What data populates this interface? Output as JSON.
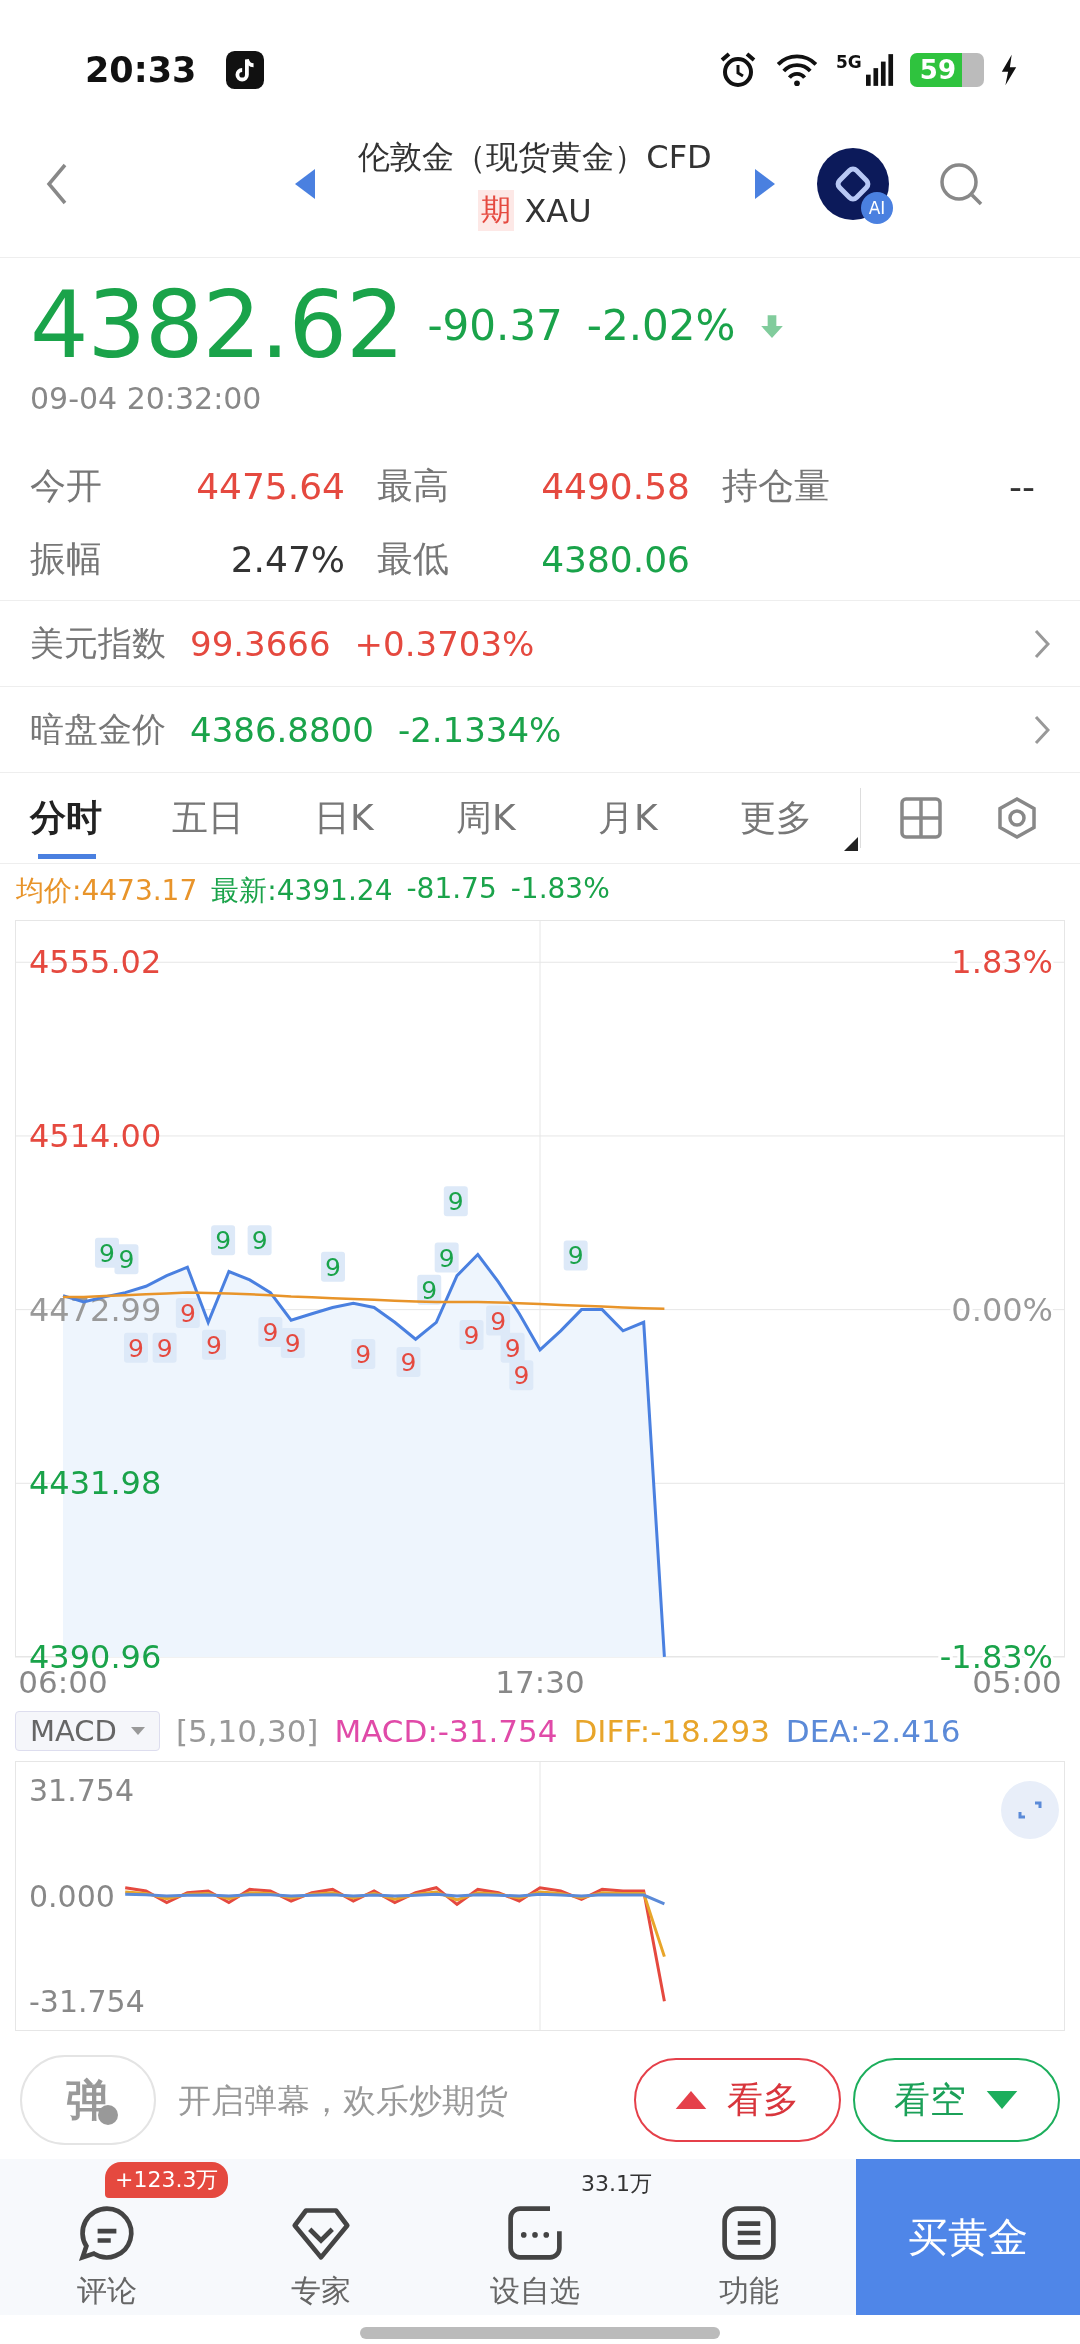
{
  "status_bar": {
    "time": "20:33",
    "network": "5G",
    "battery": "59"
  },
  "header": {
    "title": "伦敦金（现货黄金）CFD",
    "tag": "期",
    "symbol": "XAU",
    "ai_badge": "AI"
  },
  "quote": {
    "price": "4382.62",
    "change": "-90.37",
    "change_pct": "-2.02%",
    "color": "#1aa34a",
    "timestamp": "09-04 20:32:00"
  },
  "stats": [
    {
      "label": "今开",
      "value": "4475.64",
      "color": "#e5493f"
    },
    {
      "label": "最高",
      "value": "4490.58",
      "color": "#e5493f"
    },
    {
      "label": "持仓量",
      "value": "--",
      "color": "#333333"
    },
    {
      "label": "振幅",
      "value": "2.47%",
      "color": "#333333"
    },
    {
      "label": "最低",
      "value": "4380.06",
      "color": "#1aa34a"
    }
  ],
  "related": [
    {
      "label": "美元指数",
      "value": "99.3666",
      "change": "+0.3703%",
      "color": "#e5493f"
    },
    {
      "label": "暗盘金价",
      "value": "4386.8800",
      "change": "-2.1334%",
      "color": "#1aa34a"
    }
  ],
  "tabs": [
    {
      "label": "分时",
      "selected": true
    },
    {
      "label": "五日",
      "selected": false
    },
    {
      "label": "日K",
      "selected": false
    },
    {
      "label": "周K",
      "selected": false
    },
    {
      "label": "月K",
      "selected": false
    },
    {
      "label": "更多",
      "selected": false
    }
  ],
  "legend": {
    "avg": "均价:4473.17",
    "latest": "最新:4391.24",
    "change": "-81.75",
    "change_pct": "-1.83%"
  },
  "price_chart": {
    "right_labels": [
      {
        "label": "1.83%",
        "color": "#e5493f"
      },
      {
        "label": "0.00%",
        "color": "#999999"
      },
      {
        "label": "-1.83%",
        "color": "#1aa34a"
      }
    ],
    "signal_markers": [
      {
        "text": "9",
        "color": "#1aa34a"
      },
      {
        "text": "9",
        "color": "#1aa34a"
      },
      {
        "text": "9",
        "color": "#1aa34a"
      },
      {
        "text": "9",
        "color": "#1aa34a"
      },
      {
        "text": "9",
        "color": "#1aa34a"
      },
      {
        "text": "9",
        "color": "#1aa34a"
      },
      {
        "text": "9",
        "color": "#1aa34a"
      },
      {
        "text": "9",
        "color": "#1aa34a"
      },
      {
        "text": "9",
        "color": "#1aa34a"
      },
      {
        "text": "9",
        "color": "#e5493f"
      },
      {
        "text": "9",
        "color": "#e5493f"
      },
      {
        "text": "9",
        "color": "#e5493f"
      },
      {
        "text": "9",
        "color": "#e5493f"
      },
      {
        "text": "9",
        "color": "#e5493f"
      },
      {
        "text": "9",
        "color": "#e5493f"
      },
      {
        "text": "9",
        "color": "#e5493f"
      },
      {
        "text": "9",
        "color": "#e5493f"
      },
      {
        "text": "9",
        "color": "#e5493f"
      },
      {
        "text": "9",
        "color": "#e5493f"
      },
      {
        "text": "9",
        "color": "#e5493f"
      },
      {
        "text": "9",
        "color": "#e5493f"
      }
    ],
    "chart_data": {
      "type": "line",
      "categories": [
        "06:00",
        null,
        null,
        null,
        null,
        null,
        null,
        null,
        null,
        null,
        null,
        null,
        null,
        null,
        null,
        null,
        null,
        null,
        null,
        null,
        null,
        null,
        null,
        "17:30",
        null,
        null,
        null,
        null,
        null,
        null,
        null,
        null,
        null,
        null,
        null,
        null,
        null,
        null,
        null,
        null,
        null,
        null,
        null,
        null,
        null,
        null,
        "05:00"
      ],
      "series": [
        {
          "color": "#4a80e0",
          "values": [
            4476.3,
            4474.8,
            4476,
            4477,
            4478.5,
            4481,
            4483,
            4470,
            4482,
            4480,
            4477,
            4470.5,
            4472,
            4473.5,
            4474.5,
            4473.5,
            4470,
            4466,
            4470,
            4481,
            4486,
            4479.5,
            4472,
            4463.5,
            4468,
            4473,
            4473,
            4468,
            4470,
            4391,
            null,
            null,
            null,
            null,
            null,
            null,
            null,
            null,
            null,
            null,
            null,
            null,
            null,
            null,
            null,
            null,
            null
          ]
        },
        {
          "color": "#e8942a",
          "values": [
            4476,
            4476,
            4476.2,
            4476.4,
            4476.6,
            4476.8,
            4477,
            4476.9,
            4476.8,
            4476.6,
            4476.4,
            4476.1,
            4475.9,
            4475.7,
            4475.5,
            4475.3,
            4475.1,
            4474.9,
            4474.8,
            4474.8,
            4474.8,
            4474.7,
            4474.5,
            4474.3,
            4474.1,
            4473.9,
            4473.7,
            4473.5,
            4473.3,
            4473.2,
            null,
            null,
            null,
            null,
            null,
            null,
            null,
            null,
            null,
            null,
            null,
            null,
            null,
            null,
            null,
            null,
            null
          ]
        }
      ],
      "ylim": [
        4390.96,
        4565
      ],
      "grid": true,
      "yticks": [
        {
          "value": 4555.02,
          "label": "4555.02"
        },
        {
          "value": 4514.0,
          "label": "4514.00"
        },
        {
          "value": 4472.99,
          "label": "4472.99"
        },
        {
          "value": 4431.98,
          "label": "4431.98"
        },
        {
          "value": 4390.96,
          "label": "4390.96"
        }
      ]
    }
  },
  "indicator": {
    "selector": "MACD",
    "params": "[5,10,30]",
    "macd": "MACD:-31.754",
    "diff": "DIFF:-18.293",
    "dea": "DEA:-2.416"
  },
  "macd_chart": {
    "chart_data": {
      "type": "line",
      "categories": [
        null,
        null,
        null,
        null,
        null,
        null,
        null,
        null,
        null,
        null,
        null,
        null,
        null,
        null,
        null,
        null,
        null,
        null,
        null,
        null,
        null,
        null,
        null,
        null,
        null,
        null,
        null,
        null,
        null,
        null,
        null,
        null,
        null,
        null,
        null,
        null,
        null,
        null,
        null,
        null,
        null,
        null,
        null,
        null,
        null,
        null,
        null
      ],
      "series": [
        {
          "color": "#e5493f",
          "values": [
            null,
            null,
            null,
            2.5,
            1.5,
            -2,
            1,
            1.5,
            -2,
            2,
            1.5,
            -1.5,
            1,
            2,
            -1.5,
            1.5,
            -2,
            1,
            2.5,
            -2.5,
            2,
            1,
            -1.5,
            2.5,
            1.5,
            -1,
            2,
            1.5,
            1.5,
            -31.8,
            null,
            null,
            null,
            null,
            null,
            null,
            null,
            null,
            null,
            null,
            null,
            null,
            null,
            null,
            null,
            null,
            null
          ]
        },
        {
          "color": "#e8a52a",
          "values": [
            null,
            null,
            null,
            1.2,
            0.8,
            -0.8,
            0.5,
            0.8,
            -0.8,
            1,
            0.8,
            -0.6,
            0.5,
            1,
            -0.6,
            0.8,
            -1,
            0.5,
            1.2,
            -1.2,
            1,
            0.5,
            -0.6,
            1.2,
            0.8,
            -0.5,
            1,
            0.8,
            0.8,
            -18.3,
            null,
            null,
            null,
            null,
            null,
            null,
            null,
            null,
            null,
            null,
            null,
            null,
            null,
            null,
            null,
            null,
            null
          ]
        },
        {
          "color": "#5b8ad8",
          "values": [
            null,
            null,
            null,
            0.5,
            0.4,
            0,
            0.2,
            0.3,
            0,
            0.4,
            0.4,
            0,
            0.2,
            0.4,
            0,
            0.3,
            0,
            0.2,
            0.5,
            0,
            0.4,
            0.2,
            0,
            0.5,
            0.3,
            0,
            0.4,
            0.3,
            0.3,
            -2.4,
            null,
            null,
            null,
            null,
            null,
            null,
            null,
            null,
            null,
            null,
            null,
            null,
            null,
            null,
            null,
            null,
            null
          ]
        }
      ],
      "ylim": [
        -40.8,
        40.8
      ],
      "yticks": [
        {
          "value": 31.754,
          "label": "31.754"
        },
        {
          "value": 0,
          "label": "0.000"
        },
        {
          "value": -31.754,
          "label": "-31.754"
        }
      ]
    }
  },
  "danmaku": {
    "button": "弹",
    "placeholder": "开启弹幕，欢乐炒期货"
  },
  "sentiment_buttons": [
    {
      "label": "看多",
      "kind": "bull"
    },
    {
      "label": "看空",
      "kind": "bear"
    }
  ],
  "bottom_nav": [
    {
      "label": "评论",
      "kind": "comment",
      "badge": "+123.3万"
    },
    {
      "label": "专家",
      "kind": "expert"
    },
    {
      "label": "设自选",
      "kind": "watchlist",
      "count": "33.1万"
    },
    {
      "label": "功能",
      "kind": "menu"
    }
  ],
  "buy_button": "买黄金"
}
